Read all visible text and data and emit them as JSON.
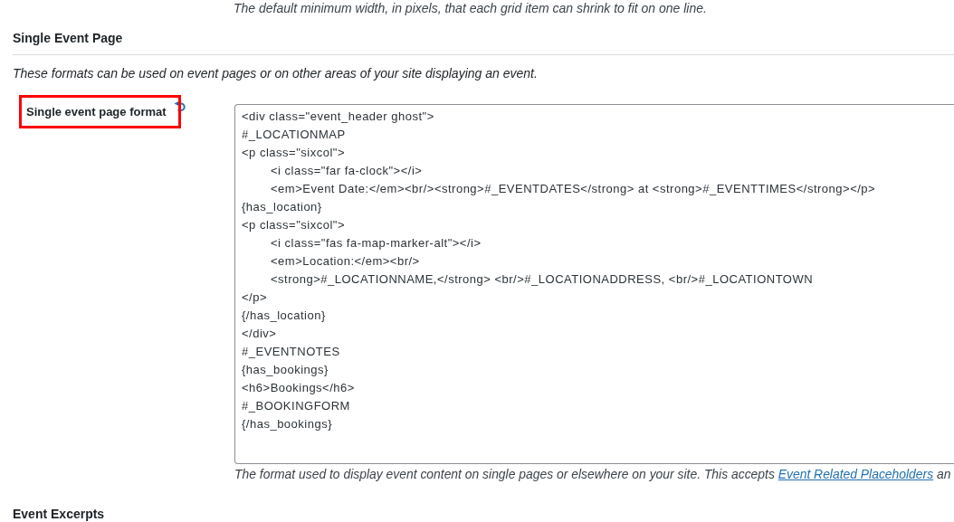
{
  "previous_field_help": "The default minimum width, in pixels, that each grid item can shrink to fit on one line.",
  "section": {
    "title": "Single Event Page",
    "description": "These formats can be used on event pages or on other areas of your site displaying an event."
  },
  "fields": [
    {
      "label": "Single event page format",
      "highlighted": true,
      "value": "<div class=\"event_header ghost\">\n#_LOCATIONMAP\n<p class=\"sixcol\">\n\t<i class=\"far fa-clock\"></i>\n\t<em>Event Date:</em><br/><strong>#_EVENTDATES</strong> at <strong>#_EVENTTIMES</strong></p>\n{has_location}\n<p class=\"sixcol\">\n\t<i class=\"fas fa-map-marker-alt\"></i>\n\t<em>Location:</em><br/>\n\t<strong>#_LOCATIONNAME,</strong> <br/>#_LOCATIONADDRESS, <br/>#_LOCATIONTOWN\n</p>\n{/has_location}\n</div>\n#_EVENTNOTES\n{has_bookings}\n<h6>Bookings</h6>\n#_BOOKINGFORM\n{/has_bookings}",
      "help": {
        "text": "The format used to display event content on single pages or elsewhere on your site. This accepts ",
        "link": "Event Related Placeholders",
        "after": " an"
      }
    }
  ],
  "next_section": {
    "title": "Event Excerpts"
  }
}
